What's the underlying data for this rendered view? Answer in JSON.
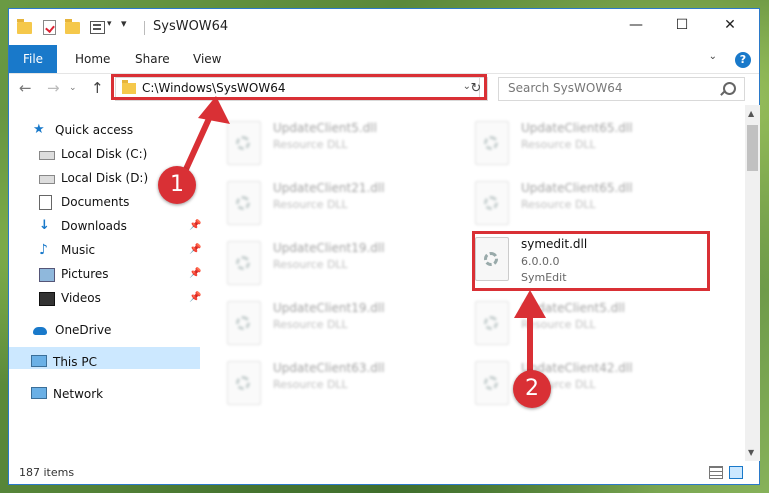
{
  "window": {
    "title": "SysWOW64",
    "controls": {
      "minimize": "—",
      "maximize": "☐",
      "close": "✕"
    }
  },
  "ribbon": {
    "file": "File",
    "tabs": [
      "Home",
      "Share",
      "View"
    ],
    "help": "?"
  },
  "address": {
    "path": "C:\\Windows\\SysWOW64",
    "search_placeholder": "Search SysWOW64"
  },
  "sidebar": {
    "items": [
      {
        "label": "Quick access",
        "icon": "star-icon"
      },
      {
        "label": "Local Disk (C:)",
        "icon": "drive-icon"
      },
      {
        "label": "Local Disk (D:)",
        "icon": "drive-icon"
      },
      {
        "label": "Documents",
        "icon": "documents-icon"
      },
      {
        "label": "Downloads",
        "icon": "downloads-icon"
      },
      {
        "label": "Music",
        "icon": "music-icon"
      },
      {
        "label": "Pictures",
        "icon": "pictures-icon"
      },
      {
        "label": "Videos",
        "icon": "videos-icon"
      },
      {
        "label": "OneDrive",
        "icon": "cloud-icon"
      },
      {
        "label": "This PC",
        "icon": "computer-icon"
      },
      {
        "label": "Network",
        "icon": "network-icon"
      }
    ]
  },
  "files": [
    {
      "name": "UpdateClient5.dll",
      "line1": "Resource DLL"
    },
    {
      "name": "UpdateClient65.dll",
      "line1": "Resource DLL"
    },
    {
      "name": "UpdateClient21.dll",
      "line1": "Resource DLL"
    },
    {
      "name": "UpdateClient65.dll",
      "line1": "Resource DLL"
    },
    {
      "name": "UpdateClient19.dll",
      "line1": "Resource DLL"
    },
    {
      "name": "symedit.dll",
      "line1": "6.0.0.0",
      "line2": "SymEdit"
    },
    {
      "name": "UpdateClient19.dll",
      "line1": "Resource DLL"
    },
    {
      "name": "UpdateClient5.dll",
      "line1": "Resource DLL"
    },
    {
      "name": "UpdateClient63.dll",
      "line1": "Resource DLL"
    },
    {
      "name": "UpdateClient42.dll",
      "line1": "Resource DLL"
    }
  ],
  "status": {
    "item_count": "187 items"
  },
  "annotations": {
    "marker1": "1",
    "marker2": "2",
    "color": "#d93035"
  }
}
